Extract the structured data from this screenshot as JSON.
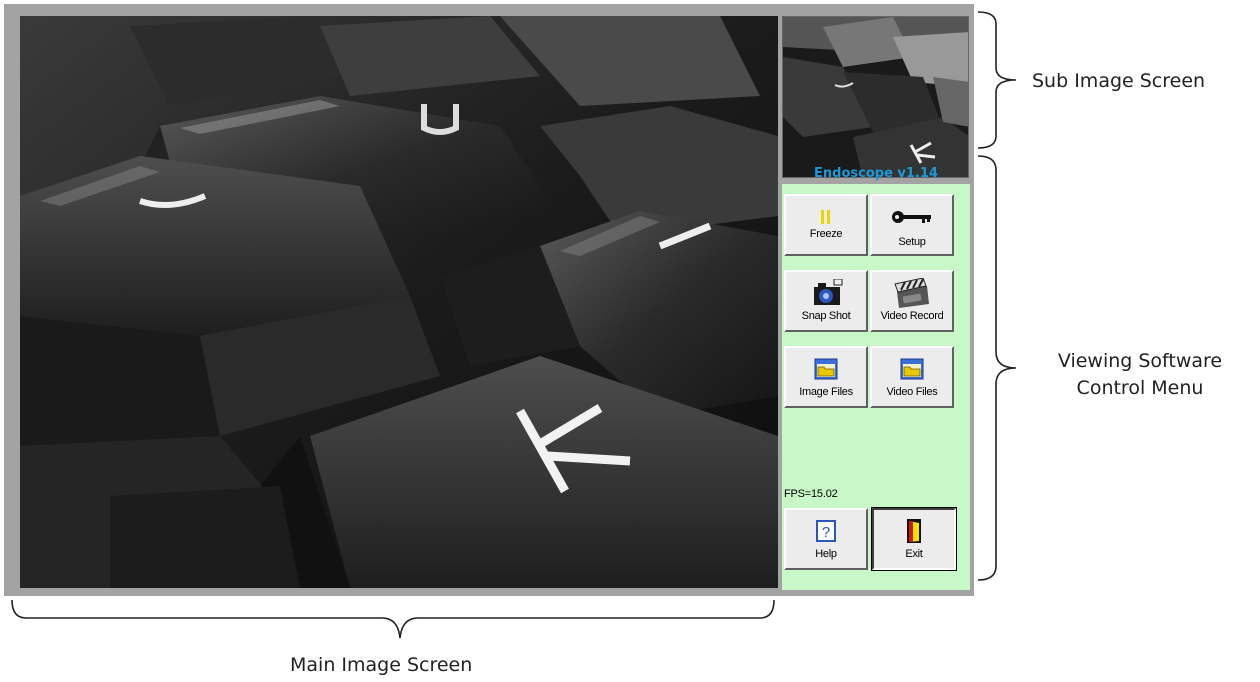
{
  "control_panel": {
    "title": "Endoscope v1.14",
    "fps": "FPS=15.02",
    "buttons": {
      "freeze": "Freeze",
      "setup": "Setup",
      "snapshot": "Snap Shot",
      "video_record": "Video Record",
      "image_files": "Image Files",
      "video_files": "Video Files",
      "help": "Help",
      "exit": "Exit"
    }
  },
  "annotations": {
    "sub_image": "Sub Image Screen",
    "viewing_line1": "Viewing Software",
    "viewing_line2": "Control Menu",
    "main_image": "Main Image Screen"
  },
  "colors": {
    "panel_bg": "#c8f8c8",
    "title": "#1a9ad8",
    "frame": "#a3a3a3"
  }
}
